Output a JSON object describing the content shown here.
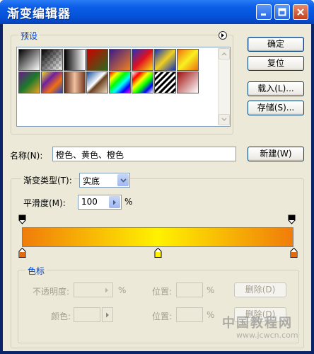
{
  "window": {
    "title": "渐变编辑器",
    "minimize_icon": "minimize-icon",
    "maximize_icon": "maximize-icon",
    "close_icon": "close-icon"
  },
  "buttons": {
    "ok": "确定",
    "reset": "复位",
    "load": "载入(L)...",
    "save": "存储(S)...",
    "new": "新建(W)",
    "delete_opacity": "删除(D)",
    "delete_color": "删除(D)"
  },
  "presets": {
    "label": "预设",
    "menu_icon": "flyout-menu-icon",
    "swatches": [
      {
        "name": "foreground-to-background",
        "css": "linear-gradient(135deg,#000 0%,#fff 100%)"
      },
      {
        "name": "foreground-to-transparent",
        "css": "linear-gradient(135deg,#000 0%,rgba(0,0,0,0) 100%)"
      },
      {
        "name": "black-white",
        "css": "linear-gradient(90deg,#000,#fff)"
      },
      {
        "name": "red-green",
        "css": "linear-gradient(135deg,#c00 0%,#2a6b1a 100%)"
      },
      {
        "name": "violet-orange",
        "css": "linear-gradient(135deg,#3a1a8a 0%,#f08020 100%)"
      },
      {
        "name": "blue-red-yellow",
        "css": "linear-gradient(135deg,#2030c0 0%,#e01020 50%,#f8e010 100%)"
      },
      {
        "name": "blue-yellow-blue",
        "css": "linear-gradient(135deg,#1030c0 0%,#f0d020 50%,#1030c0 100%)"
      },
      {
        "name": "orange-yellow-orange",
        "css": "linear-gradient(135deg,#f07010 0%,#f8f020 50%,#f07010 100%)"
      },
      {
        "name": "violet-green-orange",
        "css": "linear-gradient(135deg,#6a1a8a 0%,#1a7a2a 50%,#f0a020 100%)"
      },
      {
        "name": "yellow-violet-orange-blue",
        "css": "linear-gradient(135deg,#f0e020 0%,#7020a0 35%,#f07010 65%,#2040d0 100%)"
      },
      {
        "name": "copper",
        "css": "linear-gradient(90deg,#5a2a18 0%,#f0c0a0 50%,#7a3a20 100%)"
      },
      {
        "name": "chrome",
        "css": "linear-gradient(135deg,#1a4fa0 0%,#ffffff 45%,#6a4020 55%,#f0e0c0 100%)"
      },
      {
        "name": "spectrum",
        "css": "linear-gradient(135deg,#f00 0%,#ff0 20%,#0f0 40%,#0ff 60%,#00f 80%,#f0f 100%)"
      },
      {
        "name": "transparent-rainbow",
        "css": "linear-gradient(135deg,#fff 0%,#f00 20%,#ff0 40%,#0f0 60%,#00f 80%,#fff 100%)"
      },
      {
        "name": "transparent-stripes",
        "css": "repeating-linear-gradient(135deg,#000 0,#000 3px,#fff 3px,#fff 6px)"
      },
      {
        "name": "red-white",
        "css": "linear-gradient(135deg,#a01010 0%,#ffffff 100%)"
      }
    ]
  },
  "name_field": {
    "label": "名称(N):",
    "value": "橙色、黄色、橙色"
  },
  "gradient": {
    "type_label": "渐变类型(T):",
    "type_value": "实底",
    "smoothness_label": "平滑度(M):",
    "smoothness_value": "100",
    "percent": "%",
    "bar_css": "linear-gradient(90deg,#f07c0a 0%,#fff200 50%,#f07c0a 100%)",
    "color_stops": [
      {
        "location": 0,
        "color": "#e26b10"
      },
      {
        "location": 0.5,
        "color": "#fff200"
      },
      {
        "location": 1,
        "color": "#e26b10"
      }
    ]
  },
  "color_stops_group": {
    "label": "色标",
    "opacity_label": "不透明度:",
    "opacity_percent": "%",
    "location_label_1": "位置:",
    "location_percent_1": "%",
    "color_label": "颜色:",
    "location_label_2": "位置:",
    "location_percent_2": "%"
  },
  "watermark": {
    "text": "中国教程网",
    "url": "www.jcwcn.com"
  }
}
